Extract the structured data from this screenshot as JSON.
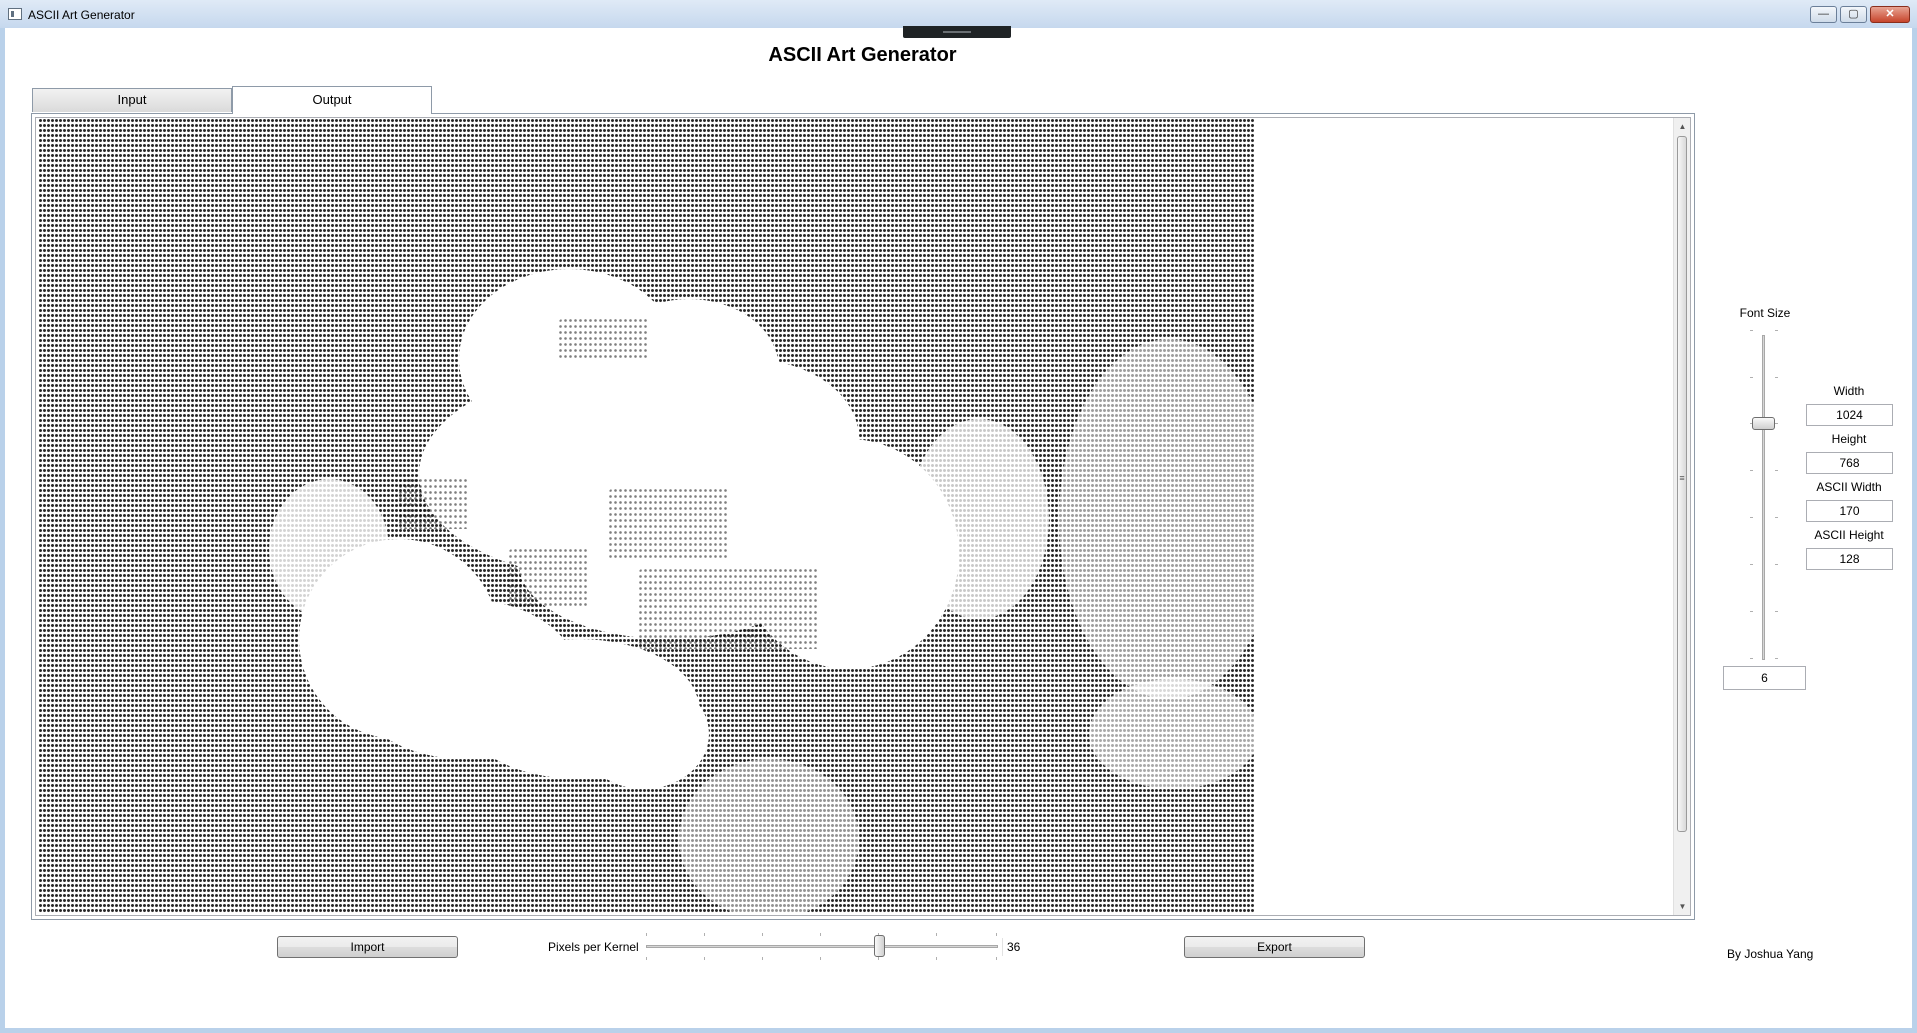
{
  "window": {
    "title": "ASCII Art Generator",
    "minimize_glyph": "—",
    "maximize_glyph": "▢",
    "close_glyph": "✕"
  },
  "app": {
    "heading": "ASCII Art Generator",
    "credit": "By Joshua Yang"
  },
  "tabs": [
    {
      "label": "Input",
      "selected": false
    },
    {
      "label": "Output",
      "selected": true
    }
  ],
  "output": {
    "content": "ASCII art rendering of a cloud image (dense character grid)"
  },
  "font_size": {
    "label": "Font Size",
    "value": "6"
  },
  "dimensions": {
    "width_label": "Width",
    "width_value": "1024",
    "height_label": "Height",
    "height_value": "768",
    "ascii_width_label": "ASCII Width",
    "ascii_width_value": "170",
    "ascii_height_label": "ASCII Height",
    "ascii_height_value": "128"
  },
  "controls": {
    "import_label": "Import",
    "export_label": "Export",
    "kernel_label": "Pixels per Kernel",
    "kernel_value": "36"
  },
  "icons": [
    "app-icon",
    "minimize-icon",
    "maximize-icon",
    "close-icon",
    "scroll-up-icon",
    "scroll-down-icon"
  ]
}
